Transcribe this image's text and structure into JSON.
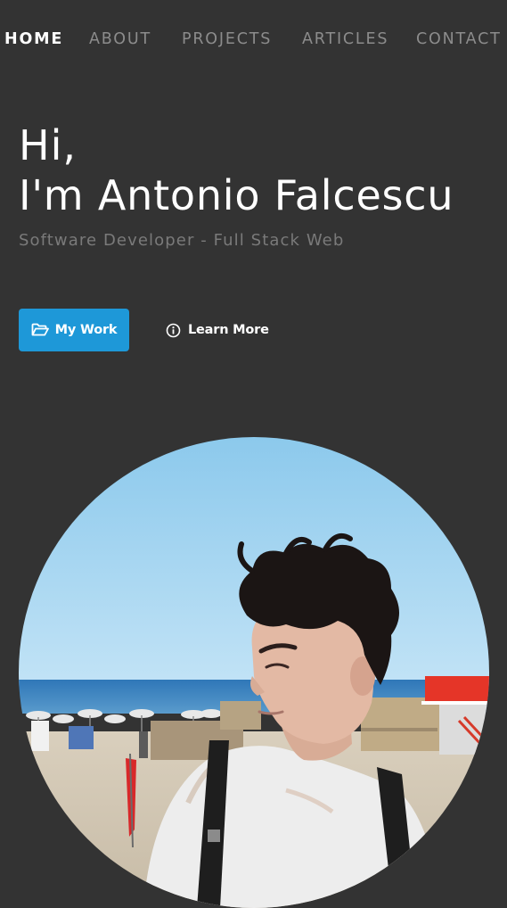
{
  "nav": {
    "items": [
      {
        "label": "HOME",
        "active": true
      },
      {
        "label": "ABOUT",
        "active": false
      },
      {
        "label": "PROJECTS",
        "active": false
      },
      {
        "label": "ARTICLES",
        "active": false
      },
      {
        "label": "CONTACT",
        "active": false
      }
    ]
  },
  "hero": {
    "greeting": "Hi,",
    "name": "I'm Antonio Falcescu",
    "subtitle": "Software Developer - Full Stack Web",
    "primary_button": {
      "label": "My Work",
      "icon": "folder-open-icon"
    },
    "secondary_button": {
      "label": "Learn More",
      "icon": "info-circle-icon"
    }
  },
  "colors": {
    "background": "#333333",
    "accent": "#1e98d8",
    "text_primary": "#ffffff",
    "text_muted": "#7a7a7a",
    "nav_inactive": "#8c8c8c"
  }
}
